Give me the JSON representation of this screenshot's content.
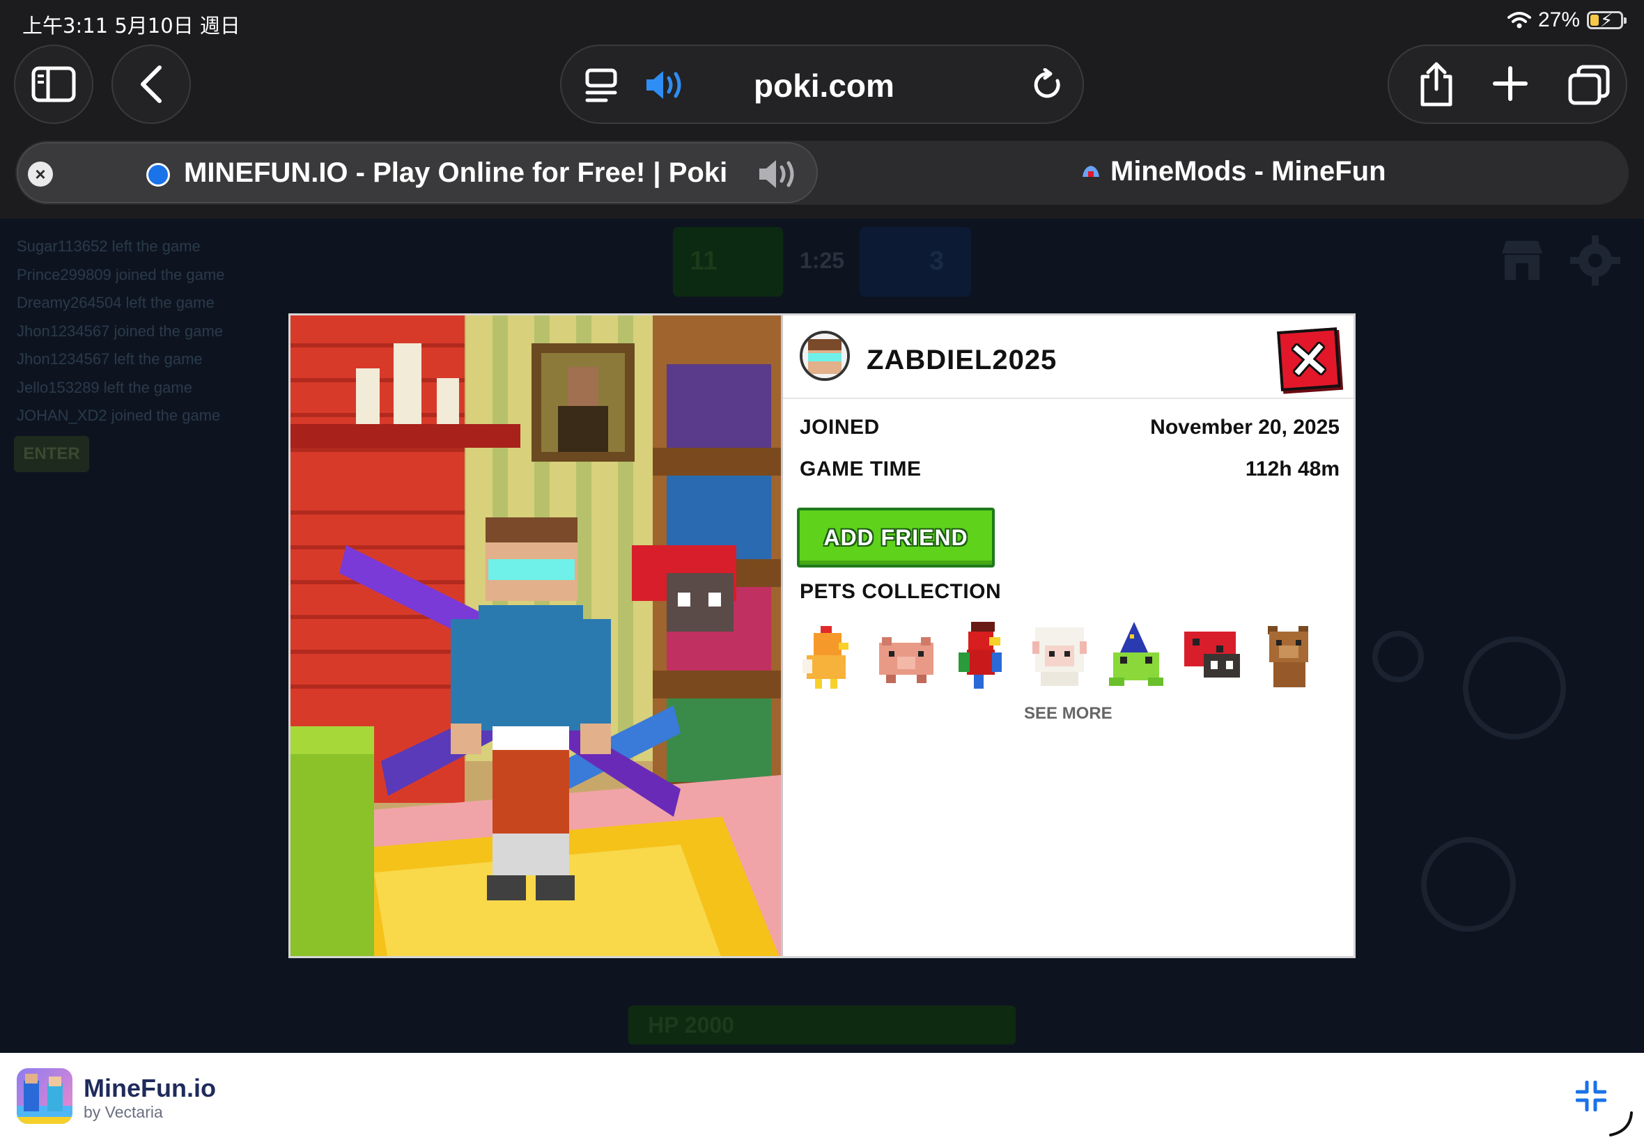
{
  "status": {
    "time": "上午3:11  5月10日 週日",
    "battery": "27%"
  },
  "browser": {
    "address": "poki.com",
    "tabs": [
      {
        "title": "MINEFUN.IO - Play Online for Free! | Poki",
        "active": true
      },
      {
        "title": "MineMods - MineFun",
        "active": false
      }
    ]
  },
  "game": {
    "chat": [
      "Sugar113652 left the game",
      "Prince299809 joined the game",
      "Dreamy264504 left the game",
      "Jhon1234567 joined the game",
      "Jhon1234567 left the game",
      "Jello153289 left the game",
      "JOHAN_XD2 joined the game"
    ],
    "enter_label": "ENTER",
    "score_left": "11",
    "timer": "1:25",
    "score_right": "3",
    "hp_label": "HP 2000"
  },
  "profile": {
    "username": "ZABDIEL2025",
    "joined_label": "JOINED",
    "joined_value": "November 20, 2025",
    "game_time_label": "GAME TIME",
    "game_time_value": "112h 48m",
    "add_friend_label": "ADD FRIEND",
    "pets_title": "PETS COLLECTION",
    "see_more_label": "SEE MORE",
    "pets": [
      "chicken-pet",
      "pig-pet",
      "parrot-pet",
      "sheep-pet",
      "wizard-frog-pet",
      "ladybug-pet",
      "bear-pet"
    ]
  },
  "bottom": {
    "app_name": "MineFun.io",
    "app_by": "by Vectaria"
  },
  "colors": {
    "close_red": "#e3172a",
    "add_friend_green": "#5fd21c",
    "audio_blue": "#2f8ef5"
  }
}
